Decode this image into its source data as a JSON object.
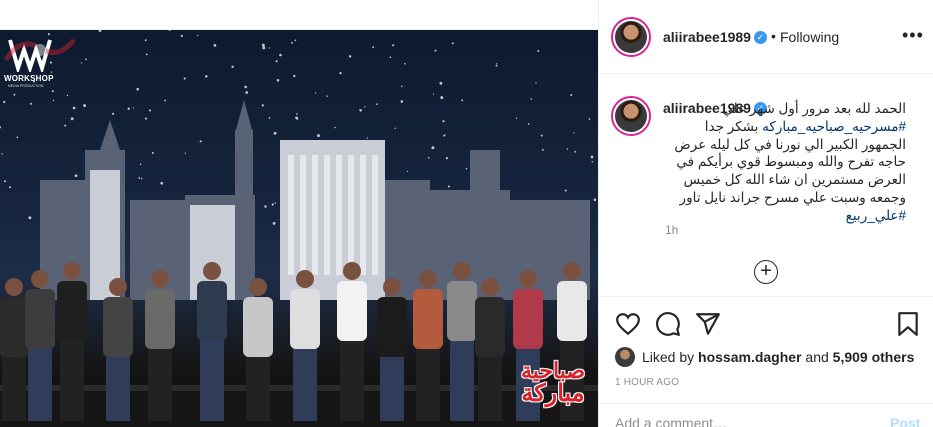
{
  "photo": {
    "logo_text": "WORKSHOP",
    "logo_subtext": "MEDIA PRODUCTION",
    "show_title_line1": "صباحية",
    "show_title_line2": "مباركة"
  },
  "post": {
    "username": "aliirabee1989",
    "follow_status": "Following",
    "verified": true
  },
  "caption": {
    "username": "aliirabee1989",
    "text_part1": "الحمد لله بعد مرور أول شهر علي ",
    "hashtag1": "#مسرحيه_صباحيه_مباركه",
    "text_part2": " بشكر جدا الجمهور الكبير الي نورنا في كل ليله عرض حاجه تفرح والله ومبسوط قوي برأيكم في العرض مستمرين ان شاء الله كل خميس وجمعه وسبت علي مسرح جراند نايل تاور ",
    "hashtag2": "#علي_ربيع",
    "time_ago": "1h"
  },
  "engagement": {
    "liked_prefix": "Liked by ",
    "liked_user": "hossam.dagher",
    "liked_middle": " and ",
    "others_count": "5,909 others",
    "post_date": "1 HOUR AGO"
  },
  "comment": {
    "placeholder": "Add a comment…",
    "post_label": "Post"
  },
  "colors": {
    "accent_link": "#00376b",
    "verified_blue": "#3897f0",
    "post_button": "#b2dffc",
    "avatar_ring": "#d6249f"
  }
}
